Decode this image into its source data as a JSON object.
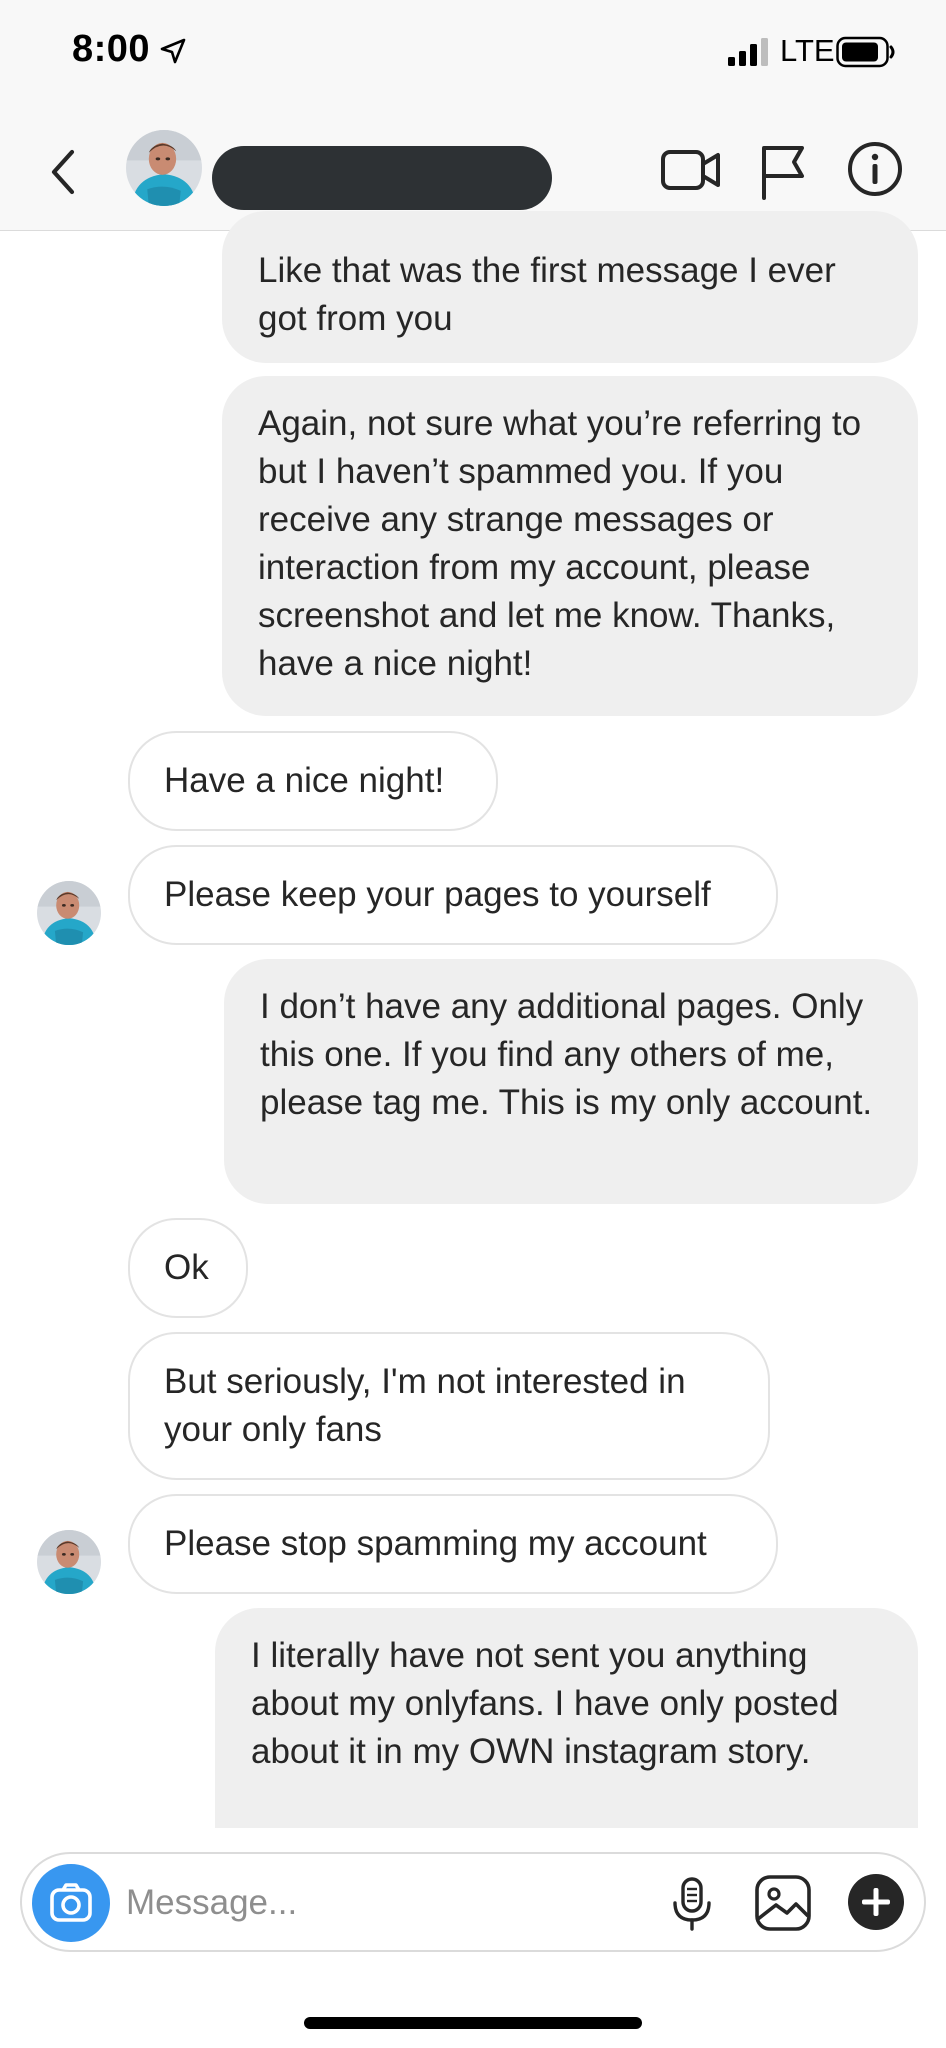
{
  "status_bar": {
    "time": "8:00",
    "network": "LTE",
    "icons": [
      "location-arrow-icon",
      "signal-icon",
      "battery-icon"
    ]
  },
  "header": {
    "icons": [
      "chevron-left-icon",
      "video-camera-icon",
      "flag-icon",
      "info-icon"
    ]
  },
  "messages": [
    {
      "direction": "outgoing",
      "text": "Like that was the first message I ever got from you"
    },
    {
      "direction": "outgoing",
      "text": "Again, not sure what you’re referring to but I haven’t spammed you. If you receive any strange messages or interaction from my account, please screenshot and let me know. Thanks, have a nice night!"
    },
    {
      "direction": "incoming",
      "text": "Have a nice night!"
    },
    {
      "direction": "incoming",
      "text": "Please keep your pages to yourself"
    },
    {
      "direction": "outgoing",
      "text": "I don’t have any additional pages. Only this one. If you find any others of me, please tag me. This is my only account."
    },
    {
      "direction": "incoming",
      "text": "Ok"
    },
    {
      "direction": "incoming",
      "text": "But seriously, I'm not interested in your only fans"
    },
    {
      "direction": "incoming",
      "text": "Please stop spamming my account"
    },
    {
      "direction": "outgoing",
      "text": "I literally have not sent you anything about my onlyfans. I have only posted about it in my OWN instagram story."
    }
  ],
  "composer": {
    "value": "",
    "placeholder": "Message...",
    "icons": [
      "camera-icon",
      "microphone-icon",
      "gallery-icon",
      "plus-icon"
    ]
  },
  "colors": {
    "bar_background": "#f8f8f8",
    "outgoing_bubble": "#efefef",
    "incoming_border": "#e3e3e3",
    "camera_accent": "#3897f0",
    "redaction": "#2d3134"
  }
}
